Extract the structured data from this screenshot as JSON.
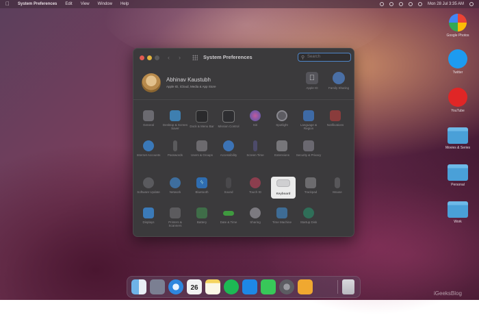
{
  "menubar": {
    "app_name": "System Preferences",
    "items": [
      "Edit",
      "View",
      "Window",
      "Help"
    ],
    "clock": "Mon 28 Jul  3:35 AM"
  },
  "window": {
    "title": "System Preferences",
    "search_placeholder": "Search",
    "account": {
      "name": "Abhinav Kaustubh",
      "subtitle": "Apple ID, iCloud, Media & App Store"
    },
    "top_items": [
      {
        "label": "Apple ID",
        "icon": "apple-id-icon"
      },
      {
        "label": "Family Sharing",
        "icon": "family-sharing-icon"
      }
    ],
    "rows": [
      [
        {
          "label": "General",
          "icon": "general-icon"
        },
        {
          "label": "Desktop & Screen Saver",
          "icon": "desktop-icon"
        },
        {
          "label": "Dock & Menu Bar",
          "icon": "dock-icon"
        },
        {
          "label": "Mission Control",
          "icon": "mission-control-icon"
        },
        {
          "label": "Siri",
          "icon": "siri-icon"
        },
        {
          "label": "Spotlight",
          "icon": "spotlight-icon"
        },
        {
          "label": "Language & Region",
          "icon": "language-icon"
        },
        {
          "label": "Notifications",
          "icon": "notifications-icon"
        }
      ],
      [
        {
          "label": "Internet Accounts",
          "icon": "internet-accounts-icon"
        },
        {
          "label": "Passwords",
          "icon": "passwords-icon"
        },
        {
          "label": "Users & Groups",
          "icon": "users-icon"
        },
        {
          "label": "Accessibility",
          "icon": "accessibility-icon"
        },
        {
          "label": "Screen Time",
          "icon": "screen-time-icon"
        },
        {
          "label": "Extensions",
          "icon": "extensions-icon"
        },
        {
          "label": "Security & Privacy",
          "icon": "security-icon"
        }
      ],
      [
        {
          "label": "Software Update",
          "icon": "software-update-icon"
        },
        {
          "label": "Network",
          "icon": "network-icon"
        },
        {
          "label": "Bluetooth",
          "icon": "bluetooth-icon"
        },
        {
          "label": "Sound",
          "icon": "sound-icon"
        },
        {
          "label": "Touch ID",
          "icon": "touch-id-icon"
        },
        {
          "label": "Keyboard",
          "icon": "keyboard-icon"
        },
        {
          "label": "Trackpad",
          "icon": "trackpad-icon"
        },
        {
          "label": "Mouse",
          "icon": "mouse-icon"
        }
      ],
      [
        {
          "label": "Displays",
          "icon": "displays-icon"
        },
        {
          "label": "Printers & Scanners",
          "icon": "printers-icon"
        },
        {
          "label": "Battery",
          "icon": "battery-icon"
        },
        {
          "label": "Date & Time",
          "icon": "date-time-icon"
        },
        {
          "label": "Sharing",
          "icon": "sharing-icon"
        },
        {
          "label": "Time Machine",
          "icon": "time-machine-icon"
        },
        {
          "label": "Startup Disk",
          "icon": "startup-disk-icon"
        }
      ]
    ],
    "highlighted": "Keyboard"
  },
  "desktop_icons": [
    {
      "label": "Google Photos",
      "icon": "google-photos-icon"
    },
    {
      "label": "Twitter",
      "icon": "twitter-icon"
    },
    {
      "label": "YouTube",
      "icon": "youtube-icon"
    },
    {
      "label": "Movies & Series",
      "icon": "folder-icon"
    },
    {
      "label": "Personal",
      "icon": "folder-icon"
    },
    {
      "label": "Work",
      "icon": "folder-icon"
    }
  ],
  "dock": {
    "apps": [
      "Finder",
      "Launchpad",
      "Safari",
      "Calendar",
      "Notes",
      "Spotify",
      "App Store",
      "Messages",
      "System Preferences",
      "Sketch"
    ],
    "calendar_day": "26",
    "trash": "Trash"
  },
  "watermark": "iGeeksBlog"
}
